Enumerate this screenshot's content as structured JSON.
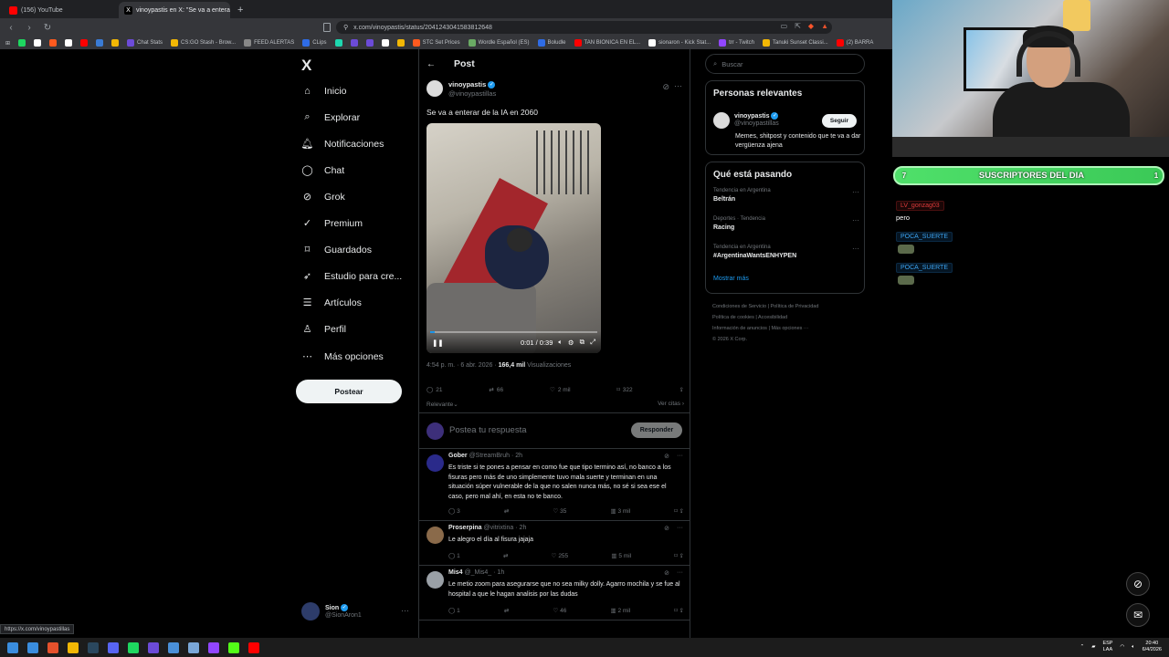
{
  "browser": {
    "tabs": [
      {
        "label": "(156) YouTube",
        "color": "#ff0000"
      },
      {
        "label": "vinoypastis en X: \"Se va a entera",
        "color": "#ffffff"
      }
    ],
    "new_tab": "+",
    "url": "x.com/vinoypastis/status/2041243041583812648",
    "bookmarks": [
      {
        "label": "",
        "color": "#1ed760"
      },
      {
        "label": "",
        "color": "#ffffff"
      },
      {
        "label": "",
        "color": "#ff5a1f"
      },
      {
        "label": "",
        "color": "#ffffff"
      },
      {
        "label": "",
        "color": "#ff0000"
      },
      {
        "label": "",
        "color": "#3a7bd5"
      },
      {
        "label": "",
        "color": "#f2b705"
      },
      {
        "label": "Chat Stats",
        "color": "#6c4bd8"
      },
      {
        "label": "CS:GO Stash - Brow...",
        "color": "#f2b705"
      },
      {
        "label": "FEED ALERTAS",
        "color": "#888888"
      },
      {
        "label": "CLips",
        "color": "#2f6ce5"
      },
      {
        "label": "",
        "color": "#1ed7b0"
      },
      {
        "label": "",
        "color": "#6c4bd8"
      },
      {
        "label": "",
        "color": "#6c4bd8"
      },
      {
        "label": "",
        "color": "#ffffff"
      },
      {
        "label": "",
        "color": "#f2b705"
      },
      {
        "label": "STC Set Prices",
        "color": "#ff5a1f"
      },
      {
        "label": "Wordle Español (ES)",
        "color": "#6aaa64"
      },
      {
        "label": "Boludle",
        "color": "#2f6ce5"
      },
      {
        "label": "TAN BIONICA EN EL...",
        "color": "#ff0000"
      },
      {
        "label": "sionaron - Kick Stat...",
        "color": "#ffffff"
      },
      {
        "label": "trr - Twitch",
        "color": "#9146ff"
      },
      {
        "label": "Tanuki Sunset Classi...",
        "color": "#f2b705"
      },
      {
        "label": "(2) BARRA",
        "color": "#ff0000"
      }
    ],
    "status_url": "https://x.com/vinoypastillas"
  },
  "nav": {
    "logo": "X",
    "items": [
      {
        "label": "Inicio",
        "icon": "⌂",
        "name": "home-icon"
      },
      {
        "label": "Explorar",
        "icon": "⌕",
        "name": "search-icon"
      },
      {
        "label": "Notificaciones",
        "icon": "🔔︎",
        "name": "bell-icon"
      },
      {
        "label": "Chat",
        "icon": "◯",
        "name": "chat-icon"
      },
      {
        "label": "Grok",
        "icon": "⊘",
        "name": "grok-icon"
      },
      {
        "label": "Premium",
        "icon": "✓",
        "name": "premium-icon"
      },
      {
        "label": "Guardados",
        "icon": "⌑",
        "name": "bookmark-icon"
      },
      {
        "label": "Estudio para cre...",
        "icon": "➶",
        "name": "rocket-icon"
      },
      {
        "label": "Artículos",
        "icon": "☰",
        "name": "articles-icon"
      },
      {
        "label": "Perfil",
        "icon": "♙",
        "name": "profile-icon"
      },
      {
        "label": "Más opciones",
        "icon": "⋯",
        "name": "more-icon"
      }
    ],
    "post_button": "Postear",
    "profile": {
      "name": "Sion",
      "handle": "@SionAron1",
      "more": "···"
    }
  },
  "post": {
    "header": "Post",
    "author_name": "vinoypastis",
    "author_handle": "@vinoypastillas",
    "text": "Se va a enterar de la IA en 2060",
    "video_time": "0:01 / 0:39",
    "video_progress": 0.03,
    "date": "4:54 p. m. · 6 abr. 2026 · ",
    "views": "166,4 mil",
    "views_label": " Visualizaciones",
    "replies": "21",
    "reposts": "66",
    "likes": "2 mil",
    "bookmarks": "322",
    "sort_label": "Relevante",
    "see_quotes": "Ver citas",
    "reply_placeholder": "Postea tu respuesta",
    "reply_button": "Responder"
  },
  "replies": [
    {
      "name": "Gober",
      "handle": "@StreamBruh",
      "time": "2h",
      "text": "Es triste si te pones a pensar en como fue que tipo termino así, no banco a los fisuras pero más de uno simplemente tuvo mala suerte y terminan en una situación súper vulnerable de la que no salen nunca más, no sé si sea ese el caso, pero mal ahí, en esta no te banco.",
      "replies": "3",
      "reposts": "",
      "likes": "35",
      "views": "3 mil",
      "avatar_color": "#2a2a8a"
    },
    {
      "name": "Proserpina",
      "handle": "@vitrixtina",
      "time": "2h",
      "text": "Le alegro el día al fisura jajaja",
      "replies": "1",
      "reposts": "",
      "likes": "255",
      "views": "5 mil",
      "avatar_color": "#8a6a4a"
    },
    {
      "name": "Mis4",
      "handle": "@_Mis4_",
      "time": "1h",
      "text": "Le metio zoom para asegurarse que no sea milky dolly. Agarro mochila y se fue al hospital a que le hagan analisis por las dudas",
      "replies": "1",
      "reposts": "",
      "likes": "46",
      "views": "2 mil",
      "avatar_color": "#9aa0a6"
    }
  ],
  "right": {
    "search_placeholder": "Buscar",
    "relevant_title": "Personas relevantes",
    "relevant_name": "vinoypastis",
    "relevant_handle": "@vinoypastillas",
    "relevant_bio": "Memes, shitpost y contenido que te va a dar vergüenza ajena",
    "follow_button": "Seguir",
    "trending_title": "Qué está pasando",
    "trends": [
      {
        "context": "Tendencia en Argentina",
        "name": "Beltrán"
      },
      {
        "context": "Deportes · Tendencia",
        "name": "Racing"
      },
      {
        "context": "Tendencia en Argentina",
        "name": "#ArgentinaWantsENHYPEN"
      }
    ],
    "show_more": "Mostrar más",
    "footer_links": [
      "Condiciones de Servicio",
      "Política de Privacidad",
      "Política de cookies",
      "Accesibilidad",
      "Información de anuncios",
      "Más opciones ···",
      "© 2026 X Corp."
    ]
  },
  "stream": {
    "subs_left": "7",
    "subs_label": "SUSCRIPTORES DEL DIA",
    "subs_right": "1",
    "chat": [
      {
        "user": "LV_gonzag03",
        "style": "red",
        "message": "pero",
        "emote": false
      },
      {
        "user": "POCA_SUERTE",
        "style": "blue",
        "message": "",
        "emote": true
      },
      {
        "user": "POCA_SUERTE",
        "style": "blue",
        "message": "",
        "emote": true
      }
    ]
  },
  "taskbar": {
    "lang_top": "ESP",
    "lang_bottom": "LAA",
    "time": "20:40",
    "date": "6/4/2026",
    "apps": [
      "#3a8dde",
      "#e5512c",
      "#f2b705",
      "#2a475e",
      "#5865f2",
      "#1ed760",
      "#6c4bd8",
      "#4a90d9",
      "#7aa7d8",
      "#9146ff",
      "#53fc18",
      "#ff0000"
    ]
  }
}
